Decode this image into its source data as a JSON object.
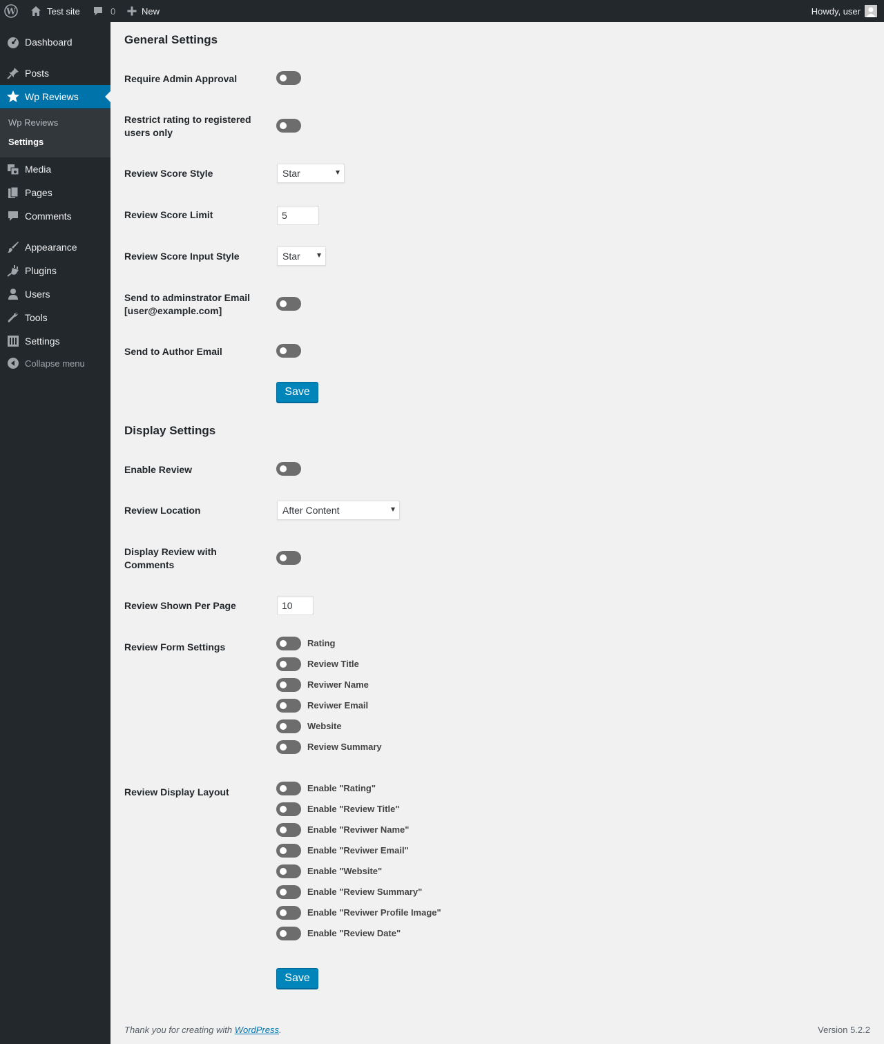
{
  "admin_bar": {
    "site_name": "Test site",
    "comments_count": "0",
    "new_label": "New",
    "howdy": "Howdy, user"
  },
  "sidebar": {
    "items": [
      {
        "label": "Dashboard",
        "icon": "dashboard-icon"
      },
      {
        "label": "Posts",
        "icon": "pin-icon"
      },
      {
        "label": "Wp Reviews",
        "icon": "star-icon"
      },
      {
        "label": "Media",
        "icon": "media-icon"
      },
      {
        "label": "Pages",
        "icon": "pages-icon"
      },
      {
        "label": "Comments",
        "icon": "comment-icon"
      },
      {
        "label": "Appearance",
        "icon": "brush-icon"
      },
      {
        "label": "Plugins",
        "icon": "plugin-icon"
      },
      {
        "label": "Users",
        "icon": "user-icon"
      },
      {
        "label": "Tools",
        "icon": "wrench-icon"
      },
      {
        "label": "Settings",
        "icon": "settings-icon"
      }
    ],
    "submenu": [
      "Wp Reviews",
      "Settings"
    ],
    "collapse_label": "Collapse menu",
    "accent_color": "#0073aa"
  },
  "general": {
    "title": "General Settings",
    "require_admin_approval": "Require Admin Approval",
    "restrict_rating": "Restrict rating to registered users only",
    "score_style_label": "Review Score Style",
    "score_style_value": "Star",
    "score_limit_label": "Review Score Limit",
    "score_limit_value": "5",
    "input_style_label": "Review Score Input Style",
    "input_style_value": "Star",
    "admin_email_label": "Send to adminstrator Email [user@example.com]",
    "author_email_label": "Send to Author Email",
    "save_label": "Save"
  },
  "display": {
    "title": "Display Settings",
    "enable_review": "Enable Review",
    "location_label": "Review Location",
    "location_value": "After Content",
    "with_comments": "Display Review with Comments",
    "per_page_label": "Review Shown Per Page",
    "per_page_value": "10",
    "form_settings_label": "Review Form Settings",
    "form_fields": [
      "Rating",
      "Review Title",
      "Reviwer Name",
      "Reviwer Email",
      "Website",
      "Review Summary"
    ],
    "layout_label": "Review Display Layout",
    "layout_fields": [
      "Enable \"Rating\"",
      "Enable \"Review Title\"",
      "Enable \"Reviwer Name\"",
      "Enable \"Reviwer Email\"",
      "Enable \"Website\"",
      "Enable \"Review Summary\"",
      "Enable \"Reviwer Profile Image\"",
      "Enable \"Review Date\""
    ],
    "save_label": "Save"
  },
  "footer": {
    "thanks_prefix": "Thank you for creating with",
    "wordpress_link": "WordPress",
    "thanks_suffix": ".",
    "version": "Version 5.2.2"
  }
}
